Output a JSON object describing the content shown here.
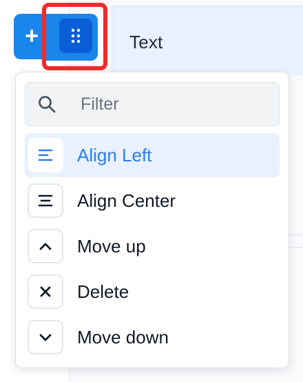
{
  "canvas": {
    "text_block_label": "Text"
  },
  "toolbar": {
    "add_label": "+"
  },
  "menu": {
    "filter_placeholder": "Filter",
    "items": [
      {
        "label": "Align Left",
        "icon": "align-left-icon",
        "active": true
      },
      {
        "label": "Align Center",
        "icon": "align-center-icon",
        "active": false
      },
      {
        "label": "Move up",
        "icon": "chevron-up-icon",
        "active": false
      },
      {
        "label": "Delete",
        "icon": "close-icon",
        "active": false
      },
      {
        "label": "Move down",
        "icon": "chevron-down-icon",
        "active": false
      }
    ]
  },
  "colors": {
    "accent": "#1a86ec",
    "handle": "#0b5fd6",
    "highlight": "#ef2b2b",
    "active_text": "#2b7de9",
    "active_bg": "#e8f1fd"
  }
}
